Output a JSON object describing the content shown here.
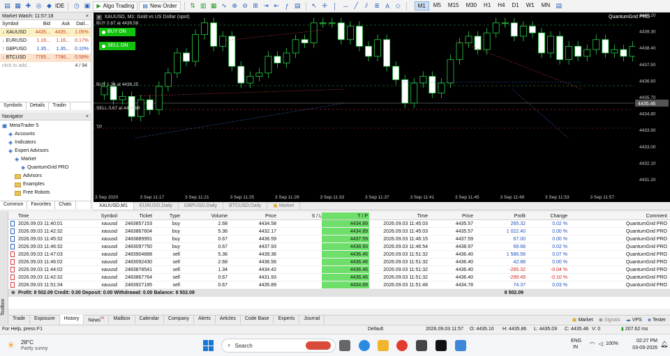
{
  "toolbar": {
    "ide_label": "IDE",
    "algo_trading_label": "Algo Trading",
    "new_order_label": "New Order",
    "timeframes": [
      "M1",
      "M5",
      "M15",
      "M30",
      "H1",
      "H4",
      "D1",
      "W1",
      "MN"
    ],
    "active_timeframe": "M1"
  },
  "market_watch": {
    "title": "Market Watch: 11:57:18",
    "headers": [
      "Symbol",
      "Bid",
      "Ask",
      "Dail..."
    ],
    "rows": [
      {
        "symbol": "XAUUSD",
        "bid": "4435...",
        "ask": "4435...",
        "daily": "1.05%",
        "bg": "#fbf1c5",
        "color": "#d23a1a"
      },
      {
        "symbol": "EURUSD",
        "bid": "1.16...",
        "ask": "1.16...",
        "daily": "0.17%",
        "bg": "#ffffff",
        "color": "#d23a1a"
      },
      {
        "symbol": "GBPUSD",
        "bid": "1.35...",
        "ask": "1.35...",
        "daily": "0.10%",
        "bg": "#ffffff",
        "color": "#1d4fc4"
      },
      {
        "symbol": "BTCUSD",
        "bid": "7785...",
        "ask": "7786...",
        "daily": "0.58%",
        "bg": "#fbe3cd",
        "color": "#d23a1a"
      }
    ],
    "add_hint": "click to add...",
    "count": "4 / 94",
    "tabs": [
      "Symbols",
      "Details",
      "Tradin"
    ]
  },
  "navigator": {
    "title": "Navigator",
    "items": [
      {
        "label": "MetaTrader 5",
        "indent": 0,
        "icon": "mt5-icon"
      },
      {
        "label": "Accounts",
        "indent": 1,
        "icon": "accounts-icon"
      },
      {
        "label": "Indicators",
        "indent": 1,
        "icon": "indicators-icon"
      },
      {
        "label": "Expert Advisors",
        "indent": 1,
        "icon": "experts-icon"
      },
      {
        "label": "Market",
        "indent": 2,
        "icon": "market-icon"
      },
      {
        "label": "QuantumGrid PRO",
        "indent": 3,
        "icon": "ea-icon"
      },
      {
        "label": "Advisors",
        "indent": 2,
        "icon": "folder-icon"
      },
      {
        "label": "Examples",
        "indent": 2,
        "icon": "folder-icon"
      },
      {
        "label": "Free Robots",
        "indent": 2,
        "icon": "folder-icon"
      }
    ],
    "tabs": [
      "Common",
      "Favorites",
      "Chats"
    ]
  },
  "chart": {
    "symbol_title": "XAUUSD, M1:  Gold vs US Dollar (spot)",
    "ea_name": "QuantumGrid PRO",
    "buy_line_label": "BUY 0.67 at 4439.58",
    "buy_line2_label": "BUY 1.34 at 4436.25",
    "sell_line_label": "SELL 0.67 at 4434.98",
    "tp_label": "TP",
    "buy_on_label": "BUY ON",
    "sell_on_label": "SELL ON",
    "current_price": "4435.46",
    "price_ticks": [
      "4440.20",
      "4439.30",
      "4438.40",
      "4437.50",
      "4436.60",
      "4435.70",
      "4434.80",
      "4433.90",
      "4433.00",
      "4432.10",
      "4431.20"
    ],
    "time_ticks": [
      "3 Sep 2020",
      "3 Sep 11:17",
      "3 Sep 11:21",
      "3 Sep 11:25",
      "3 Sep 11:29",
      "3 Sep 11:33",
      "3 Sep 11:37",
      "3 Sep 11:41",
      "3 Sep 11:45",
      "3 Sep 11:49",
      "3 Sep 11:53",
      "3 Sep 11:57"
    ]
  },
  "chart_tabs": [
    "XAUUSD,M1",
    "EURUSD,Daily",
    "GBPUSD,Daily",
    "BTCUSD,Daily",
    "Market"
  ],
  "history": {
    "headers": [
      "Time",
      "Symbol",
      "Ticket",
      "Type",
      "Volume",
      "Price",
      "S / L",
      "T / P",
      "Time",
      "Price",
      "Profit",
      "Change",
      "Comment"
    ],
    "rows": [
      [
        "2026.09.03 11:40:01",
        "xauusd",
        "2483857153",
        "buy",
        "2.68",
        "4434.58",
        "",
        "4434.89",
        "2026.09.03 11:45:03",
        "4435.57",
        "265.32",
        "0.02 %",
        "QuantumGrid PRO"
      ],
      [
        "2026.09.03 11:42:32",
        "xauusd",
        "2483867604",
        "buy",
        "5.36",
        "4432.17",
        "",
        "4434.89",
        "2026.09.03 11:45:03",
        "4435.57",
        "1 022.40",
        "0.00 %",
        "QuantumGrid PRO"
      ],
      [
        "2026.09.03 11:45:32",
        "xauusd",
        "2483889991",
        "buy",
        "0.67",
        "4436.59",
        "",
        "4437.59",
        "2026.09.03 11:46:15",
        "4437.59",
        "67.00",
        "0.00 %",
        "QuantumGrid PRO"
      ],
      [
        "2026.09.03 11:46:32",
        "xauusd",
        "2483097750",
        "buy",
        "0.67",
        "4437.93",
        "",
        "4438.93",
        "2026.09.03 11:46:54",
        "4438.97",
        "69.68",
        "0.02 %",
        "QuantumGrid PRO"
      ],
      [
        "2026.09.03 11:47:03",
        "xauusd",
        "2483904888",
        "sell",
        "5.36",
        "4439.36",
        "",
        "4436.46",
        "2026.09.03 11:51:32",
        "4436.40",
        "1 586.56",
        "0.07 %",
        "QuantumGrid PRO"
      ],
      [
        "2026.09.03 11:46:02",
        "xauusd",
        "2483092430",
        "sell",
        "2.68",
        "4436.56",
        "",
        "4436.46",
        "2026.09.03 11:51:32",
        "4436.40",
        "42.88",
        "0.00 %",
        "QuantumGrid PRO"
      ],
      [
        "2026.09.03 11:44:02",
        "xauusd",
        "2483878541",
        "sell",
        "1.34",
        "4434.42",
        "",
        "4436.46",
        "2026.09.03 11:51:32",
        "4436.40",
        "-265.32",
        "-0.04 %",
        "QuantumGrid PRO"
      ],
      [
        "2026.09.03 11:42:32",
        "xauusd",
        "2483867764",
        "sell",
        "0.67",
        "4431.93",
        "",
        "4436.46",
        "2026.09.03 11:51:32",
        "4436.40",
        "-299.49",
        "-0.10 %",
        "QuantumGrid PRO"
      ],
      [
        "2026.09.03 11:51:34",
        "xauusd",
        "2483927185",
        "sell",
        "0.67",
        "4435.89",
        "",
        "4434.89",
        "2026.09.03 11:51:48",
        "4434.78",
        "74.37",
        "0.03 %",
        "QuantumGrid PRO"
      ]
    ],
    "summary": "Profit: 8 502.09  Credit: 0.00  Deposit: 0.00  Withdrawal: 0.00  Balance: 8 502.09",
    "summary_total": "8 502.09"
  },
  "bottom_tabs": [
    "Trade",
    "Exposure",
    "History",
    "News",
    "Mailbox",
    "Calendar",
    "Company",
    "Alerts",
    "Articles",
    "Code Base",
    "Experts",
    "Journal"
  ],
  "news_badge": "64",
  "active_bottom_tab": "History",
  "bottom_right": [
    "Market",
    "Signals",
    "VPS",
    "Tester"
  ],
  "toolbox_label": "Toolbox",
  "status": {
    "help": "For Help, press F1",
    "profile": "Default",
    "time": "2026.09.03 11:57",
    "open": "O: 4435.10",
    "high": "H: 4435.86",
    "low": "L: 4435.09",
    "close": "C: 4435.46",
    "volume": "V: 0",
    "traffic": "207.62 ms"
  },
  "taskbar": {
    "weather_temp": "28°C",
    "weather_desc": "Partly sunny",
    "search_placeholder": "Search",
    "lang": "ENG",
    "region": "IN",
    "battery": "100%",
    "clock_time": "02:27 PM",
    "clock_date": "03-09-2026"
  }
}
